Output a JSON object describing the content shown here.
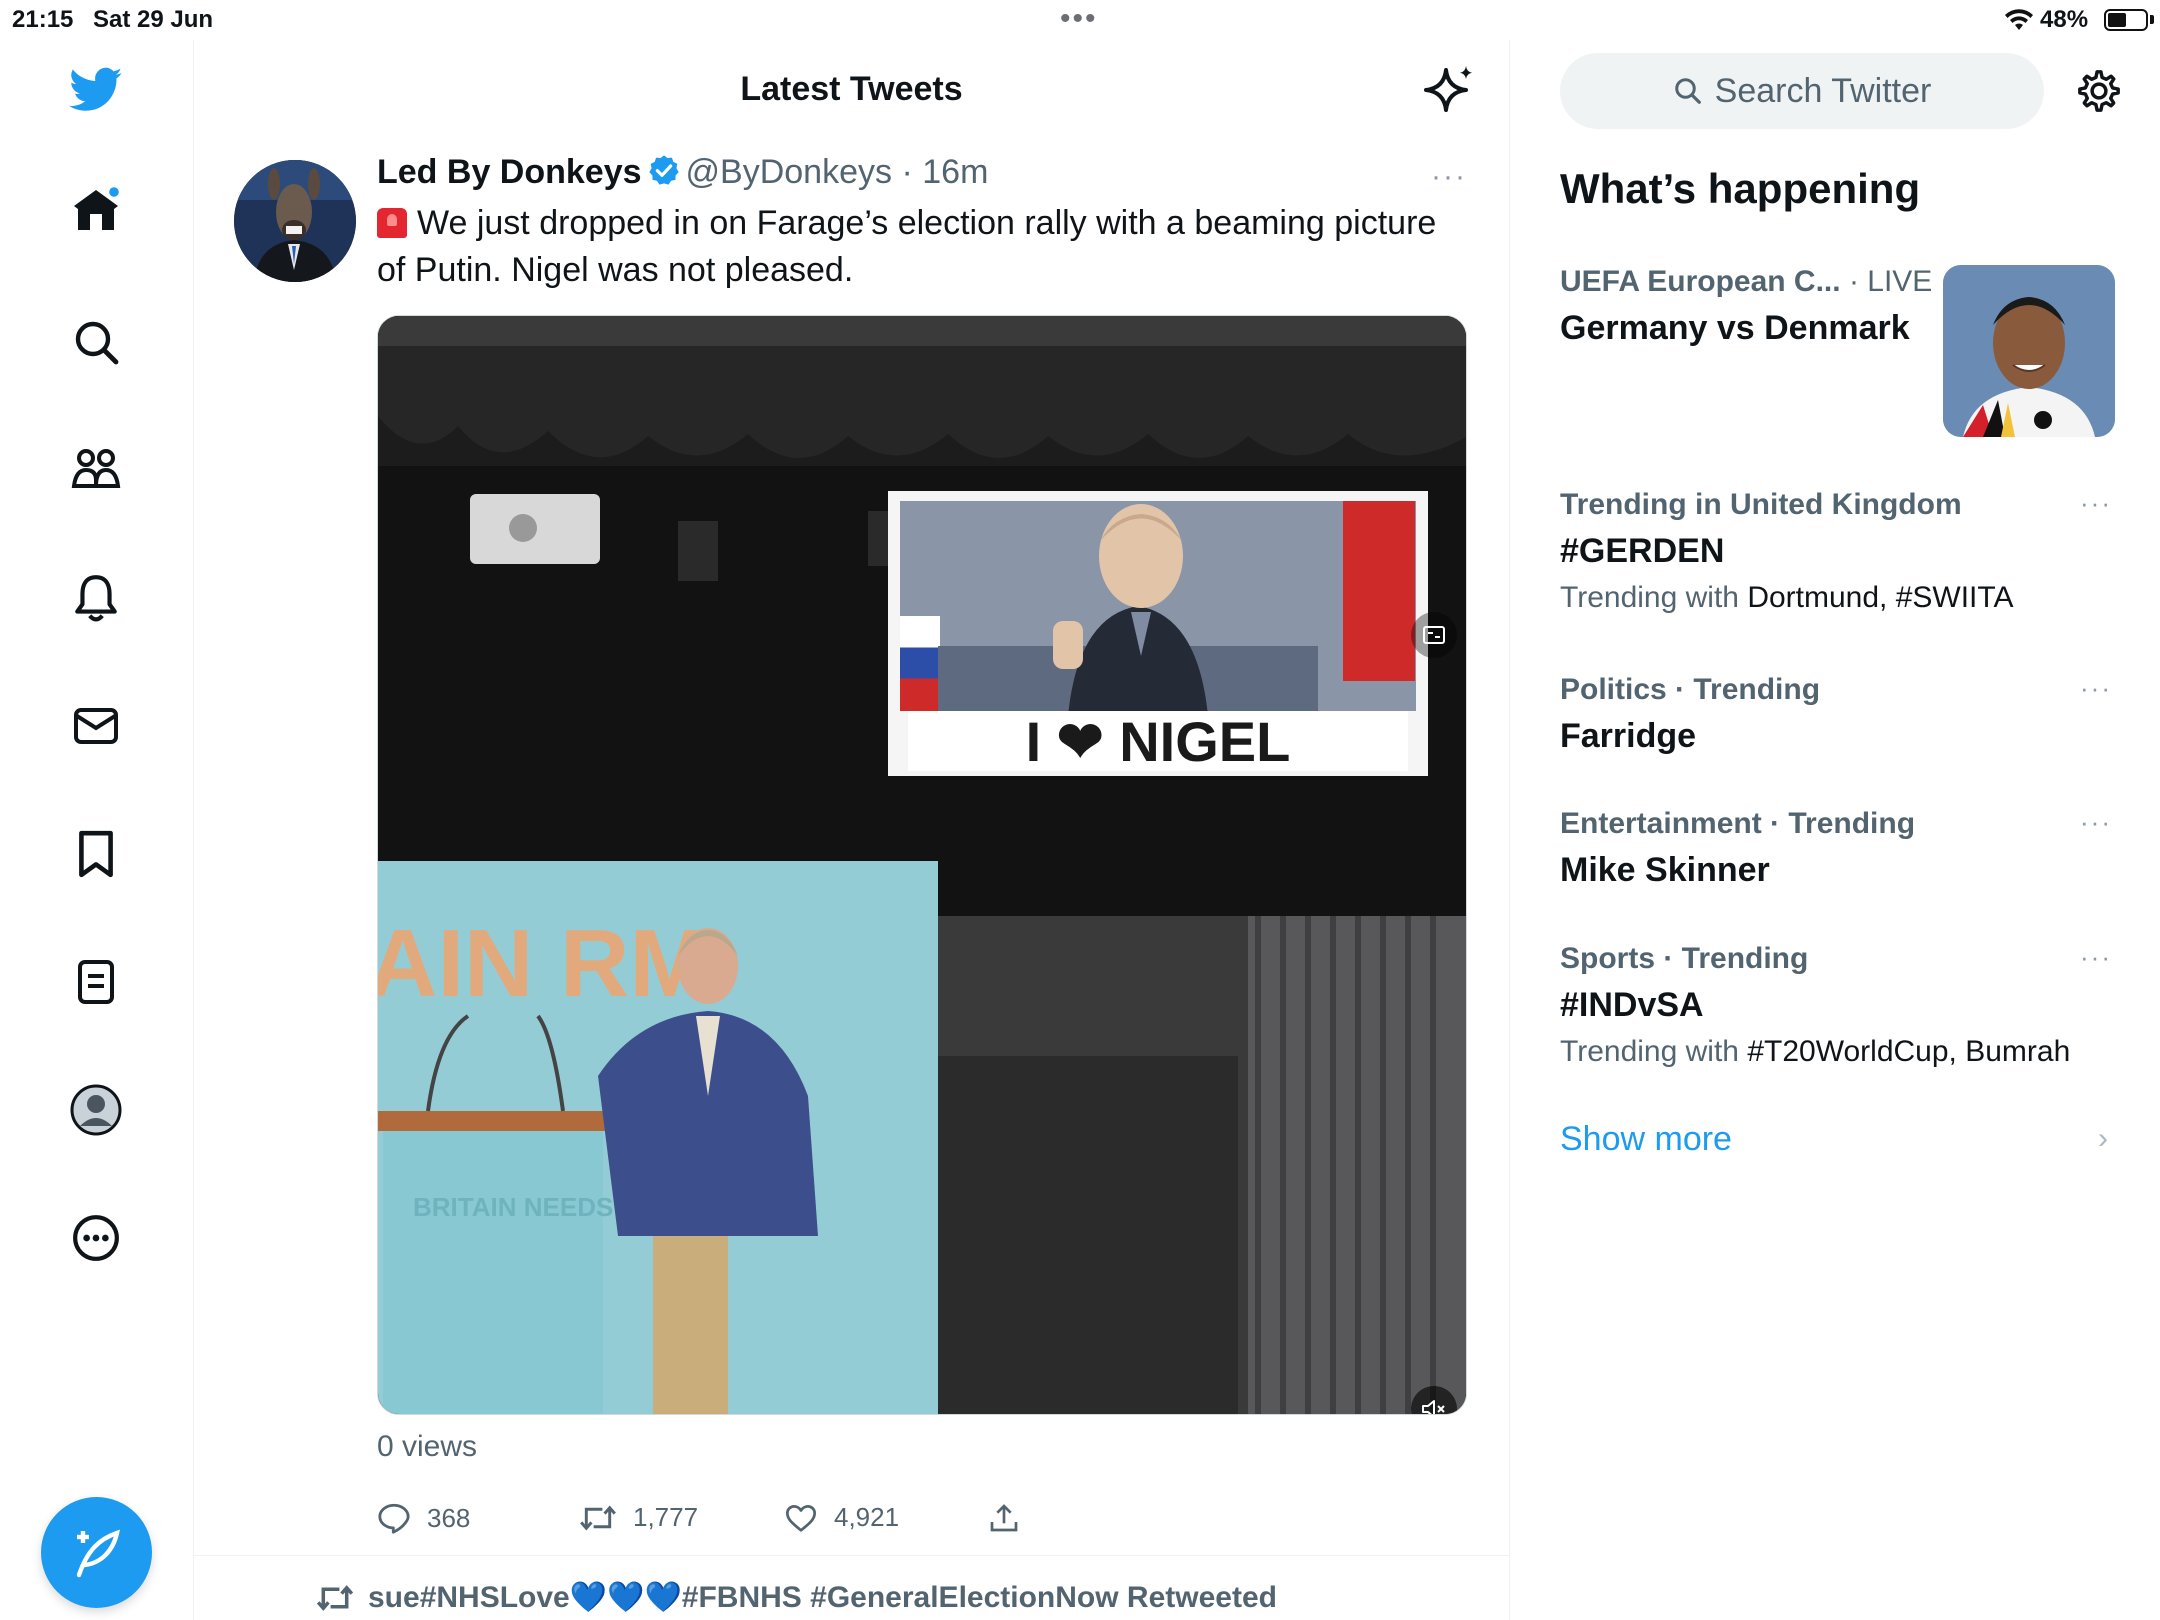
{
  "status_bar": {
    "time": "21:15",
    "date": "Sat 29 Jun",
    "battery": "48%"
  },
  "nav": {
    "items": [
      "home-icon",
      "search-icon",
      "communities-icon",
      "notifications-icon",
      "messages-icon",
      "bookmarks-icon",
      "lists-icon",
      "profile-icon",
      "more-icon"
    ],
    "compose": "compose-icon"
  },
  "header": {
    "title": "Latest Tweets"
  },
  "tweet": {
    "author_name": "Led By Donkeys",
    "handle": "@ByDonkeys",
    "separator": "·",
    "time": "16m",
    "more": "···",
    "text": "We just dropped in on Farage’s election rally with a beaming picture of Putin. Nigel was not pleased.",
    "media": {
      "banner_text": "I ❤ NIGEL",
      "lectern_text": "BRITAIN NEEDS REFORM",
      "backdrop_text": "AIN RM"
    },
    "views": "0 views",
    "replies": "368",
    "retweets": "1,777",
    "likes": "4,921"
  },
  "next_tweet": {
    "retweeted_by": "sue#NHSLove💙💙💙#FBNHS #GeneralElectionNow Retweeted"
  },
  "sidebar": {
    "search_placeholder": "Search Twitter",
    "section_title": "What’s happening",
    "event": {
      "context": "UEFA European C...",
      "live": "· LIVE",
      "title": "Germany vs Denmark"
    },
    "trends": [
      {
        "context": "Trending in United Kingdom",
        "title": "#GERDEN",
        "with_label": "Trending with",
        "with_value": "Dortmund, #SWIITA"
      },
      {
        "context": "Politics · Trending",
        "title": "Farridge",
        "with_label": "",
        "with_value": ""
      },
      {
        "context": "Entertainment · Trending",
        "title": "Mike Skinner",
        "with_label": "",
        "with_value": ""
      },
      {
        "context": "Sports · Trending",
        "title": "#INDvSA",
        "with_label": "Trending with",
        "with_value": "#T20WorldCup, Bumrah"
      }
    ],
    "trend_more": "···",
    "show_more": "Show more"
  },
  "colors": {
    "accent": "#1d9bf0",
    "text": "#0f1419",
    "secondary": "#536471",
    "border": "#eff3f4"
  }
}
